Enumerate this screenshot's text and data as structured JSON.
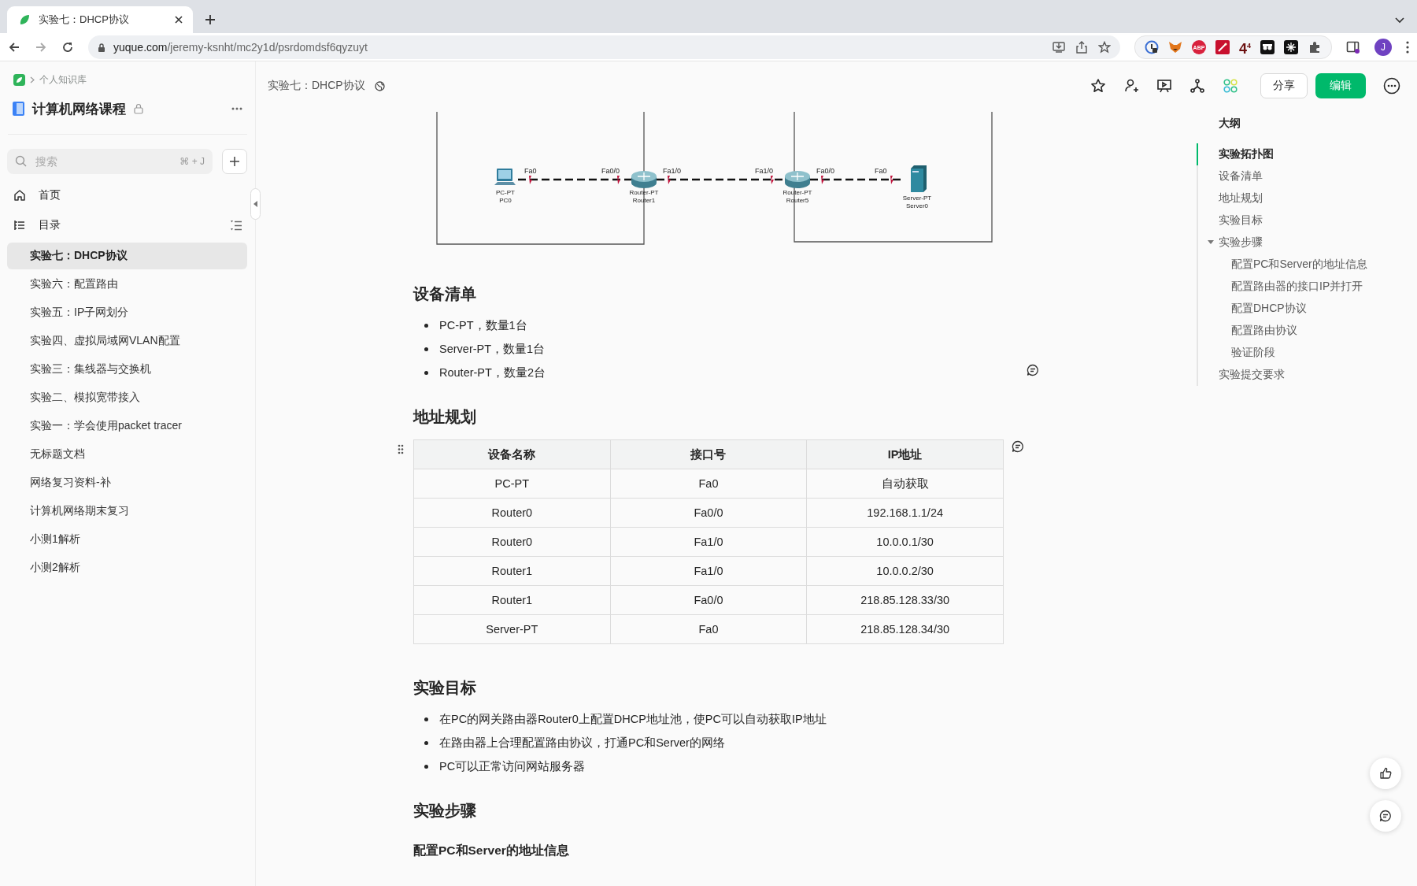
{
  "browser": {
    "tab_title": "实验七：DHCP协议",
    "url_host": "yuque.com",
    "url_path": "/jeremy-ksnht/mc2y1d/psrdomdsf6qyzuyt",
    "extension_badge": "4$^{4}$",
    "abp_label": "ABP",
    "avatar": "J"
  },
  "sidebar": {
    "breadcrumb": "个人知识库",
    "book_title": "计算机网络课程",
    "search": {
      "placeholder": "搜索",
      "shortcut": "⌘ + J"
    },
    "nav": [
      {
        "kind": "home",
        "label": "首页"
      },
      {
        "kind": "toc",
        "label": "目录"
      }
    ],
    "items": [
      {
        "label": "实验七：DHCP协议",
        "selected": true
      },
      {
        "label": "实验六：配置路由",
        "selected": false
      },
      {
        "label": "实验五：IP子网划分",
        "selected": false
      },
      {
        "label": "实验四、虚拟局域网VLAN配置",
        "selected": false
      },
      {
        "label": "实验三：集线器与交换机",
        "selected": false
      },
      {
        "label": "实验二、模拟宽带接入",
        "selected": false
      },
      {
        "label": "实验一：学会使用packet tracer",
        "selected": false
      },
      {
        "label": "无标题文档",
        "selected": false
      },
      {
        "label": "网络复习资料-补",
        "selected": false
      },
      {
        "label": "计算机网络期末复习",
        "selected": false
      },
      {
        "label": "小测1解析",
        "selected": false
      },
      {
        "label": "小测2解析",
        "selected": false
      }
    ]
  },
  "header": {
    "doc_title": "实验七：DHCP协议",
    "share": "分享",
    "edit": "编辑"
  },
  "topology": {
    "devices": [
      {
        "kind": "pc",
        "model": "PC-PT",
        "name": "PC0"
      },
      {
        "kind": "router",
        "model": "Router-PT",
        "name": "Router1"
      },
      {
        "kind": "router",
        "model": "Router-PT",
        "name": "Router5"
      },
      {
        "kind": "server",
        "model": "Server-PT",
        "name": "Server0"
      }
    ],
    "links": [
      {
        "ports": [
          "Fa0",
          "Fa0/0"
        ]
      },
      {
        "ports": [
          "Fa1/0",
          "Fa1/0"
        ]
      },
      {
        "ports": [
          "Fa0/0",
          "Fa0"
        ]
      }
    ]
  },
  "sections": [
    {
      "kind": "heading",
      "text": "设备清单"
    },
    {
      "kind": "bullets",
      "items": [
        "PC-PT，数量1台",
        "Server-PT，数量1台",
        "Router-PT，数量2台"
      ]
    },
    {
      "kind": "heading",
      "text": "地址规划"
    },
    {
      "kind": "table",
      "columns": [
        "设备名称",
        "接口号",
        "IP地址"
      ],
      "rows": [
        [
          "PC-PT",
          "Fa0",
          "自动获取"
        ],
        [
          "Router0",
          "Fa0/0",
          "192.168.1.1/24"
        ],
        [
          "Router0",
          "Fa1/0",
          "10.0.0.1/30"
        ],
        [
          "Router1",
          "Fa1/0",
          "10.0.0.2/30"
        ],
        [
          "Router1",
          "Fa0/0",
          "218.85.128.33/30"
        ],
        [
          "Server-PT",
          "Fa0",
          "218.85.128.34/30"
        ]
      ]
    },
    {
      "kind": "heading",
      "text": "实验目标"
    },
    {
      "kind": "bullets",
      "items": [
        "在PC的网关路由器Router0上配置DHCP地址池，使PC可以自动获取IP地址",
        "在路由器上合理配置路由协议，打通PC和Server的网络",
        "PC可以正常访问网站服务器"
      ]
    },
    {
      "kind": "heading",
      "text": "实验步骤"
    },
    {
      "kind": "subheading",
      "text": "配置PC和Server的地址信息"
    }
  ],
  "outline": {
    "title": "大纲",
    "items": [
      {
        "label": "实验拓扑图",
        "selected": true
      },
      {
        "label": "设备清单",
        "selected": false
      },
      {
        "label": "地址规划",
        "selected": false
      },
      {
        "label": "实验目标",
        "selected": false
      },
      {
        "label": "实验步骤",
        "selected": false,
        "expanded": true,
        "children": [
          {
            "label": "配置PC和Server的地址信息",
            "selected": false
          },
          {
            "label": "配置路由器的接口IP并打开",
            "selected": false
          },
          {
            "label": "配置DHCP协议",
            "selected": false
          },
          {
            "label": "配置路由协议",
            "selected": false
          },
          {
            "label": "验证阶段",
            "selected": false
          }
        ]
      },
      {
        "label": "实验提交要求",
        "selected": false
      }
    ]
  }
}
